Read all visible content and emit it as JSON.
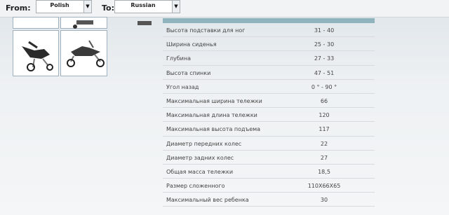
{
  "translator": {
    "from_label": "From:",
    "from_value": "Polish",
    "to_label": "To:",
    "to_value": "Russian"
  },
  "specs": [
    {
      "name": "Высота подставки для ног",
      "value": "31 - 40"
    },
    {
      "name": "Ширина сиденья",
      "value": "25 - 30"
    },
    {
      "name": "Глубина",
      "value": "27 - 33"
    },
    {
      "name": "Высота спинки",
      "value": "47 - 51"
    },
    {
      "name": "Угол назад",
      "value": "0 ° - 90 °"
    },
    {
      "name": "Максимальная ширина тележки",
      "value": "66"
    },
    {
      "name": "Максимальная длина тележки",
      "value": "120"
    },
    {
      "name": "Максимальная высота подъема",
      "value": "117"
    },
    {
      "name": "Диаметр передних колес",
      "value": "22"
    },
    {
      "name": "Диаметр задних колес",
      "value": "27"
    },
    {
      "name": "Общая масса тележки",
      "value": "18,5"
    },
    {
      "name": "Размер сложенного",
      "value": "110X66X65"
    },
    {
      "name": "Максимальный вес ребенка",
      "value": "30"
    }
  ]
}
